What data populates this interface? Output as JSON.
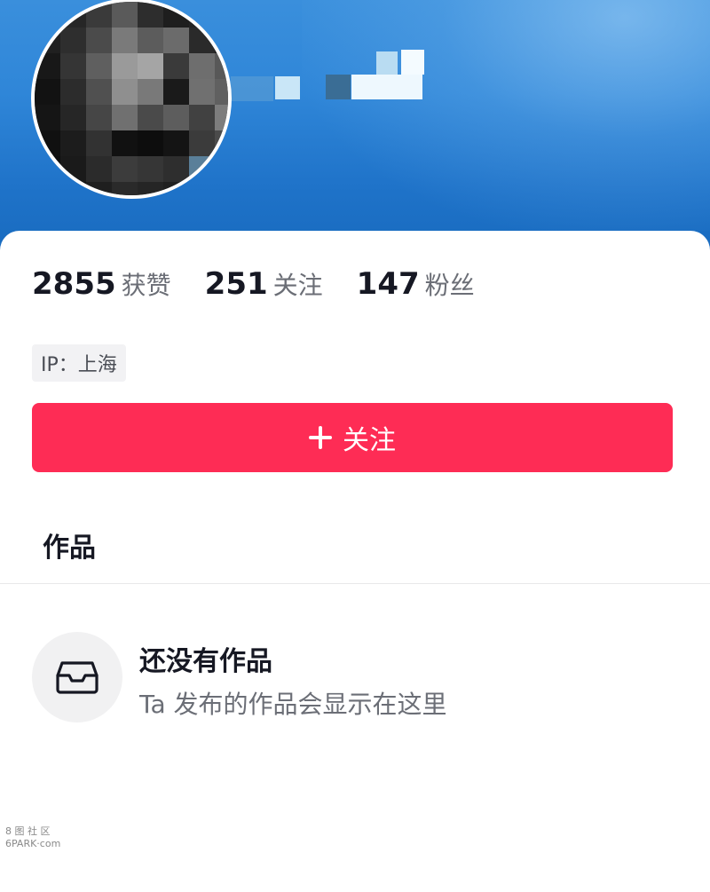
{
  "profile": {
    "stats": [
      {
        "value": "2855",
        "label": "获赞"
      },
      {
        "value": "251",
        "label": "关注"
      },
      {
        "value": "147",
        "label": "粉丝"
      }
    ],
    "ip_label": "IP：上海",
    "follow_button_label": "关注"
  },
  "tabs": {
    "works_label": "作品"
  },
  "empty_state": {
    "title": "还没有作品",
    "description": "Ta 发布的作品会显示在这里",
    "icon": "inbox-tray-icon"
  },
  "watermark": {
    "line1": "8 图 社 区",
    "line2": "6PARK·com"
  },
  "colors": {
    "accent": "#fe2c55",
    "header_blue": "#2f86d8",
    "text_primary": "#161823",
    "text_secondary": "#6b6e76"
  }
}
